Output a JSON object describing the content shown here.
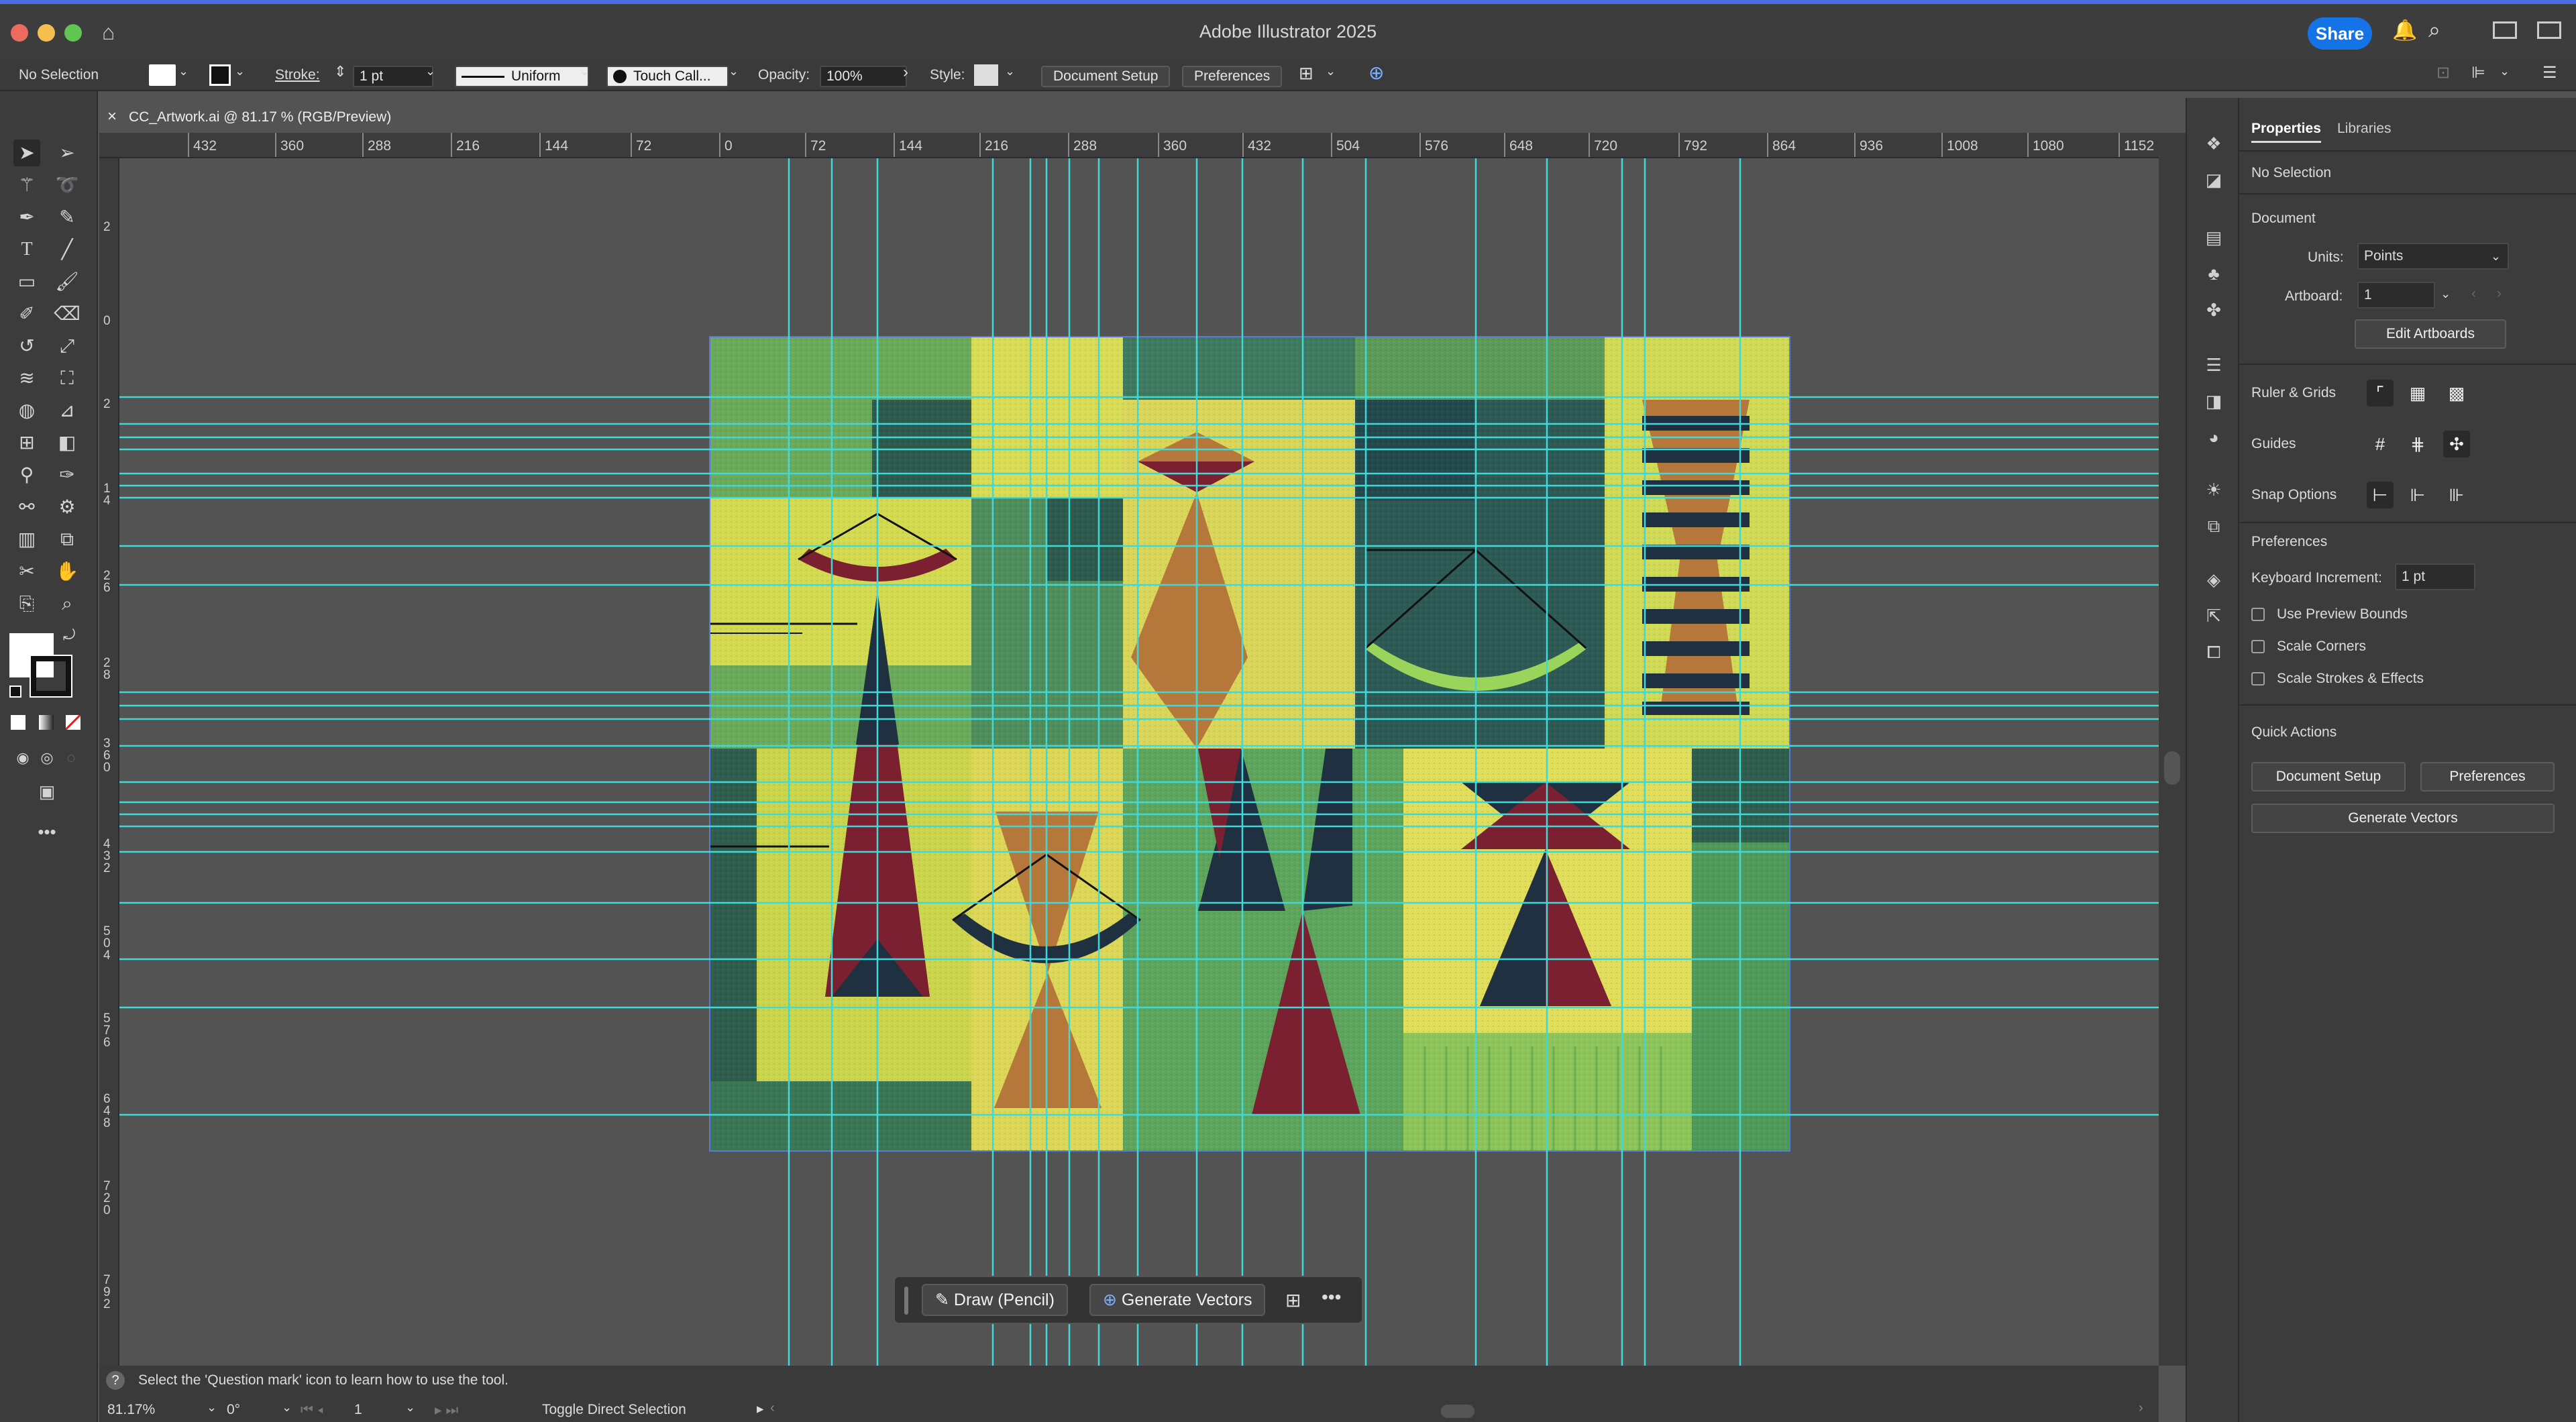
{
  "app": {
    "title": "Adobe Illustrator 2025",
    "share_label": "Share",
    "traffic_lights": [
      "#ec6a5e",
      "#f4bf4f",
      "#61c554"
    ]
  },
  "control_bar": {
    "selection": "No Selection",
    "stroke_label": "Stroke:",
    "stroke_value": "1 pt",
    "profile": "Uniform",
    "brush": "Touch Call...",
    "opacity_label": "Opacity:",
    "opacity_value": "100%",
    "style_label": "Style:",
    "document_setup": "Document Setup",
    "preferences": "Preferences"
  },
  "document": {
    "tab_title": "CC_Artwork.ai @ 81.17 % (RGB/Preview)",
    "close": "×"
  },
  "ruler": {
    "h_ticks": [
      "432",
      "360",
      "288",
      "216",
      "144",
      "72",
      "0",
      "72",
      "144",
      "216",
      "288",
      "360",
      "432",
      "504",
      "576",
      "648",
      "720",
      "792",
      "864",
      "936",
      "1008",
      "1080",
      "1152"
    ],
    "v_ticks": [
      "2",
      "0",
      "2",
      "1 4",
      "2 6",
      "2 8",
      "3 6 0",
      "4 3 2",
      "5 0 4",
      "5 7 6",
      "6 4 8",
      "7 2 0",
      "7 9 2"
    ]
  },
  "floating_bar": {
    "draw_label": "Draw (Pencil)",
    "generate_label": "Generate Vectors",
    "more": "•••"
  },
  "status": {
    "hint": "Select the 'Question mark' icon to learn how to use the tool.",
    "zoom": "81.17%",
    "rotation": "0°",
    "artboard": "1",
    "tool_state": "Toggle Direct Selection"
  },
  "panel": {
    "tabs": [
      "Properties",
      "Libraries"
    ],
    "selection": "No Selection",
    "document_heading": "Document",
    "units_label": "Units:",
    "units_value": "Points",
    "artboard_label": "Artboard:",
    "artboard_value": "1",
    "edit_artboards": "Edit Artboards",
    "ruler_grids": "Ruler & Grids",
    "guides": "Guides",
    "snap_options": "Snap Options",
    "preferences_heading": "Preferences",
    "keyboard_increment_label": "Keyboard Increment:",
    "keyboard_increment_value": "1 pt",
    "use_preview_bounds": "Use Preview Bounds",
    "scale_corners": "Scale Corners",
    "scale_strokes": "Scale Strokes & Effects",
    "quick_actions": "Quick Actions",
    "qa_document_setup": "Document Setup",
    "qa_preferences": "Preferences",
    "qa_generate_vectors": "Generate Vectors"
  },
  "colors": {
    "guide": "#3fd9d9",
    "accent": "#1473e6",
    "art_dark_green": "#2f5e4e",
    "art_lime": "#d8dc55",
    "art_green": "#6aaa5a",
    "art_rust": "#b5783a",
    "art_maroon": "#7a2030",
    "art_navy": "#1f3040"
  }
}
